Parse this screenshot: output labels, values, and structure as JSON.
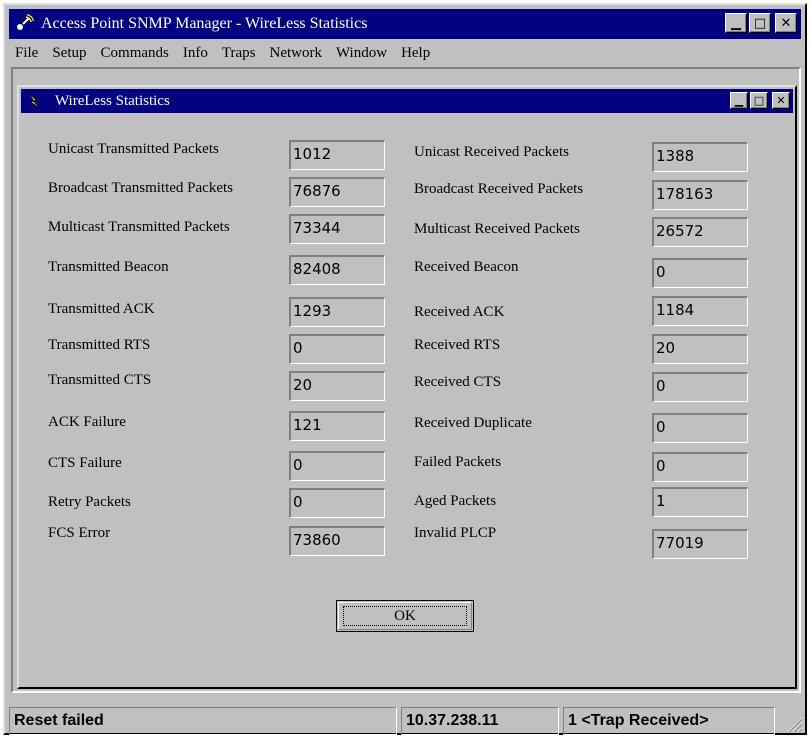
{
  "window": {
    "title": "Access Point SNMP Manager -  WireLess Statistics",
    "icon": "antenna-icon"
  },
  "menubar": {
    "items": [
      "File",
      "Setup",
      "Commands",
      "Info",
      "Traps",
      "Network",
      "Window",
      "Help"
    ]
  },
  "child_window": {
    "title": "WireLess Statistics",
    "icon": "lightning-icon"
  },
  "stats": {
    "left": [
      {
        "label": "Unicast Transmitted Packets",
        "value": "1012"
      },
      {
        "label": "Broadcast Transmitted Packets",
        "value": "76876"
      },
      {
        "label": "Multicast Transmitted Packets",
        "value": "73344"
      },
      {
        "label": "Transmitted Beacon",
        "value": "82408"
      },
      {
        "label": "Transmitted ACK",
        "value": "1293"
      },
      {
        "label": "Transmitted RTS",
        "value": "0"
      },
      {
        "label": "Transmitted CTS",
        "value": "20"
      },
      {
        "label": "ACK Failure",
        "value": "121"
      },
      {
        "label": "CTS Failure",
        "value": "0"
      },
      {
        "label": "Retry Packets",
        "value": "0"
      },
      {
        "label": "FCS Error",
        "value": "73860"
      }
    ],
    "right": [
      {
        "label": "Unicast Received Packets",
        "value": "1388"
      },
      {
        "label": "Broadcast Received Packets",
        "value": "178163"
      },
      {
        "label": "Multicast Received Packets",
        "value": "26572"
      },
      {
        "label": "Received Beacon",
        "value": "0"
      },
      {
        "label": "Received ACK",
        "value": "1184"
      },
      {
        "label": "Received RTS",
        "value": "20"
      },
      {
        "label": "Received CTS",
        "value": "0"
      },
      {
        "label": "Received Duplicate",
        "value": "0"
      },
      {
        "label": "Failed Packets",
        "value": "0"
      },
      {
        "label": "Aged Packets",
        "value": "1"
      },
      {
        "label": "Invalid PLCP",
        "value": "77019"
      }
    ]
  },
  "ok_button": {
    "label": "OK"
  },
  "statusbar": {
    "message": "Reset failed",
    "ip": "10.37.238.11",
    "trap": "1 <Trap Received>"
  }
}
